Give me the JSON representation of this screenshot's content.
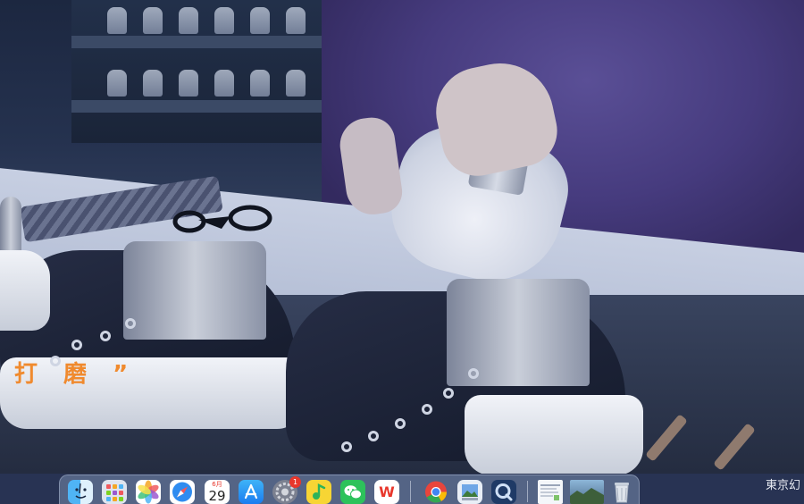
{
  "video": {
    "subtitle": "打 磨 ”"
  },
  "dock": {
    "calendar": {
      "month": "6月",
      "day": "29"
    },
    "settings_badge": "1",
    "wps_label": "W",
    "apps": [
      {
        "name": "Finder",
        "icon": "finder-icon"
      },
      {
        "name": "Launchpad",
        "icon": "launchpad-icon"
      },
      {
        "name": "Photos",
        "icon": "photos-icon"
      },
      {
        "name": "Safari",
        "icon": "safari-icon"
      },
      {
        "name": "Calendar",
        "icon": "calendar-icon"
      },
      {
        "name": "App Store",
        "icon": "app-store-icon"
      },
      {
        "name": "System Settings",
        "icon": "settings-icon"
      },
      {
        "name": "QQ Music",
        "icon": "qq-music-icon"
      },
      {
        "name": "WeChat",
        "icon": "wechat-icon"
      },
      {
        "name": "WPS Office",
        "icon": "wps-icon"
      },
      {
        "name": "Chrome",
        "icon": "chrome-icon"
      },
      {
        "name": "Preview",
        "icon": "preview-icon"
      },
      {
        "name": "QuickTime Player",
        "icon": "quicktime-icon"
      },
      {
        "name": "Document",
        "icon": "document-thumbnail-icon"
      },
      {
        "name": "Image",
        "icon": "image-thumbnail-icon"
      },
      {
        "name": "Trash",
        "icon": "trash-icon"
      }
    ]
  },
  "corner_text": "東京幻"
}
